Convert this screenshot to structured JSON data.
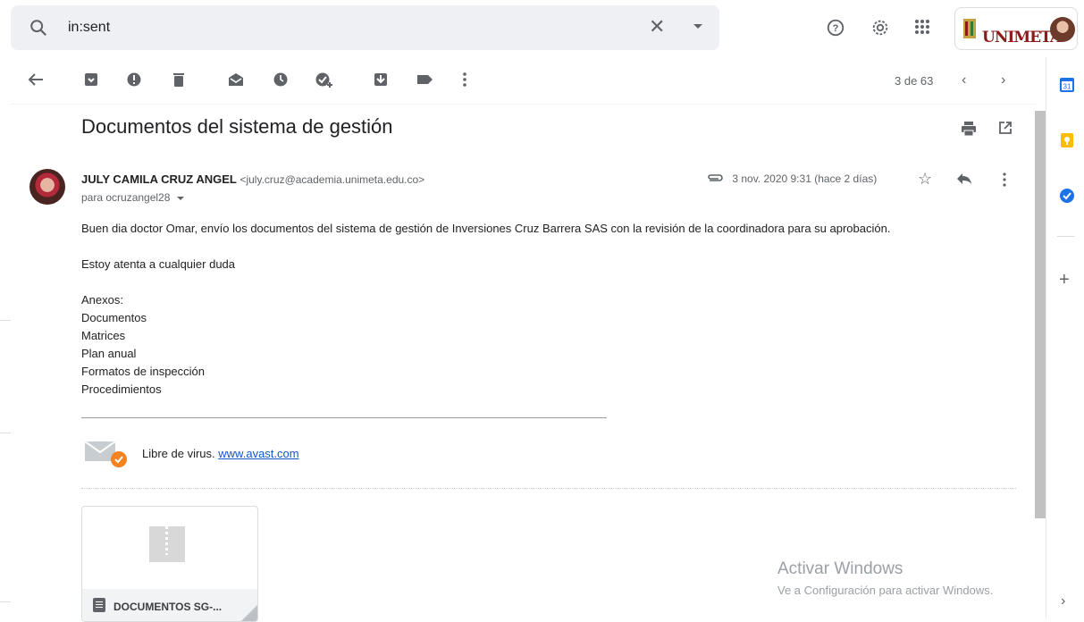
{
  "search": {
    "query": "in:sent"
  },
  "brand": {
    "logo_text": "UNIMETA"
  },
  "toolbar": {
    "count": "3 de 63"
  },
  "email": {
    "subject": "Documentos del sistema de gestión",
    "sender_name": "JULY CAMILA CRUZ ANGEL",
    "sender_email": "<july.cruz@academia.unimeta.edu.co>",
    "to": "para ocruzangel28",
    "date": "3 nov. 2020 9:31 (hace 2 días)",
    "body_lines": [
      "Buen dia doctor Omar, envío los documentos del sistema de gestión de Inversiones Cruz Barrera SAS con la revisión de la coordinadora para su aprobación.",
      "",
      "Estoy atenta a cualquier duda",
      "",
      "Anexos:",
      "Documentos",
      "Matrices",
      "Plan anual",
      "Formatos de inspección",
      "Procedimientos"
    ],
    "virus_text": "Libre de virus.",
    "virus_link": "www.avast.com",
    "attachment_name": "DOCUMENTOS SG-..."
  },
  "watermark": {
    "line1": "Activar Windows",
    "line2": "Ve a Configuración para activar Windows."
  }
}
